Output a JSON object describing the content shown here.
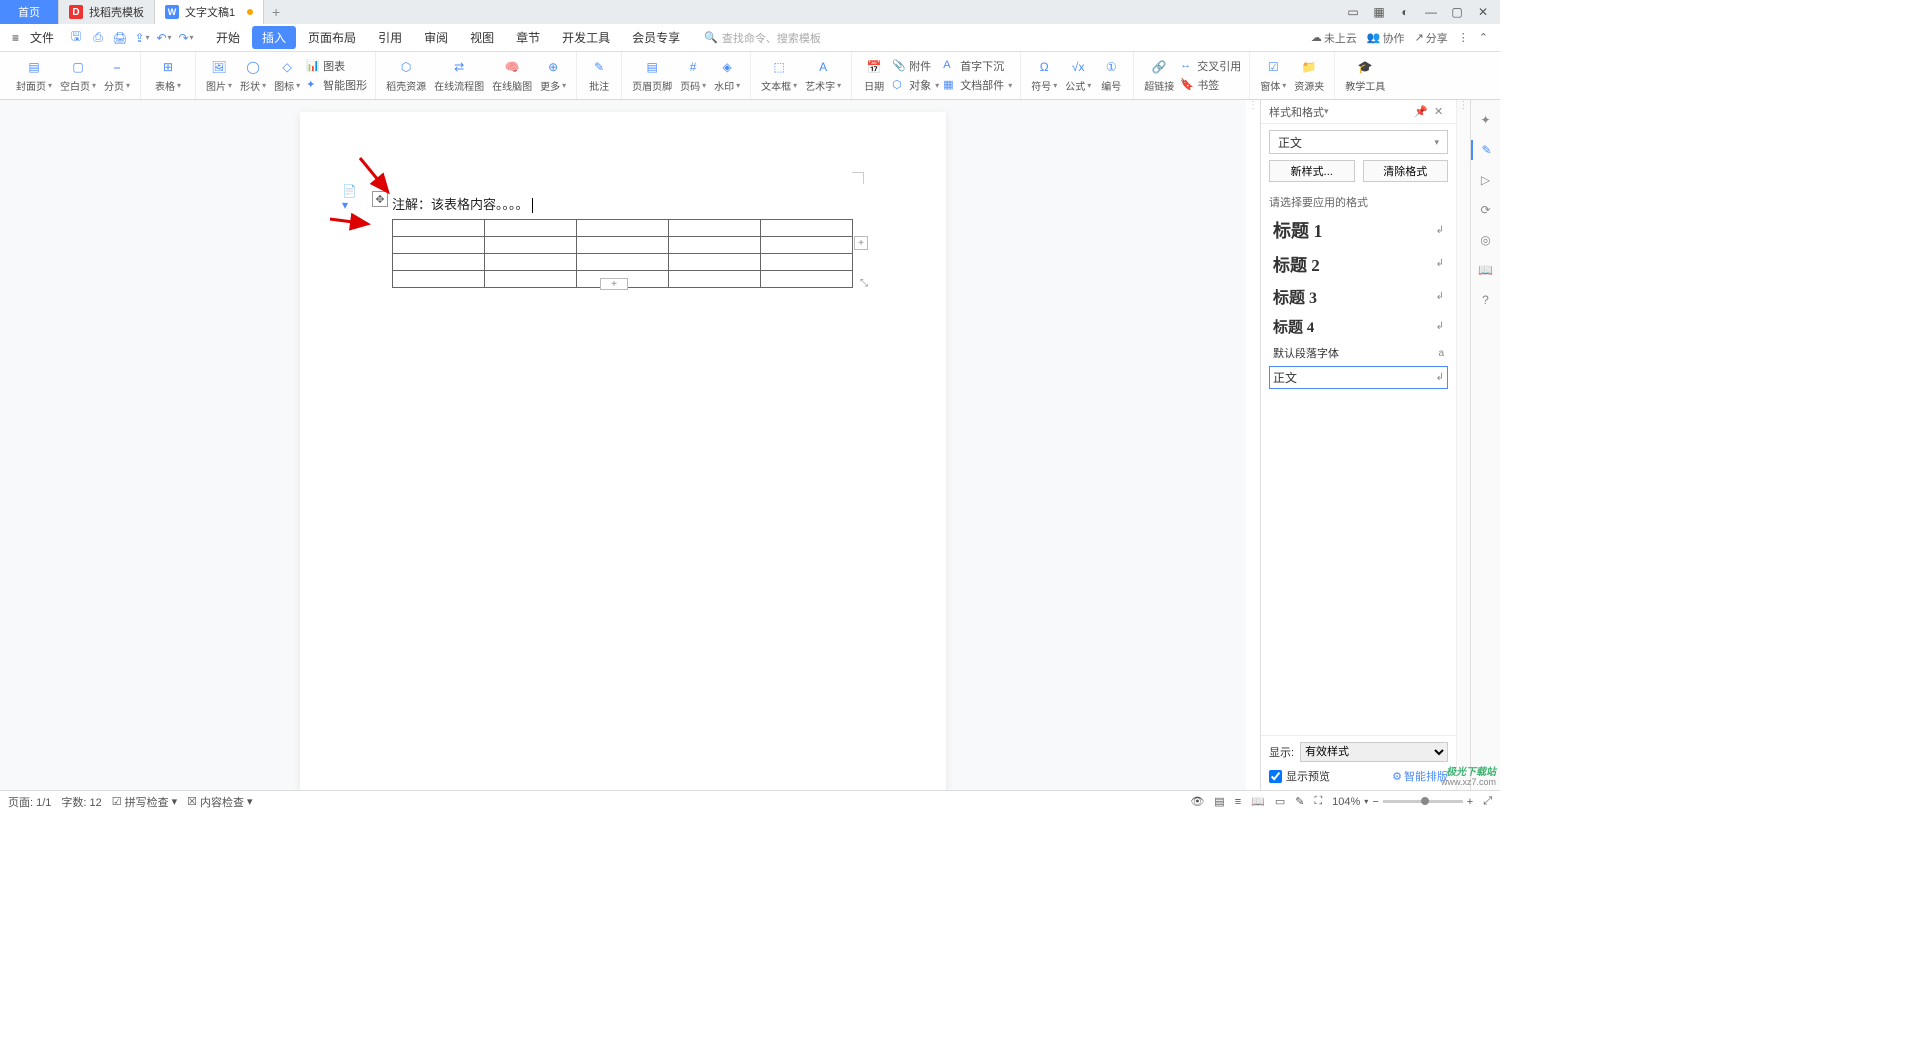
{
  "tabs": {
    "home": "首页",
    "templates": "找稻壳模板",
    "doc": "文字文稿1"
  },
  "file_menu": "文件",
  "menus": [
    "开始",
    "插入",
    "页面布局",
    "引用",
    "审阅",
    "视图",
    "章节",
    "开发工具",
    "会员专享"
  ],
  "active_menu": "插入",
  "search_placeholder": "查找命令、搜索模板",
  "top_right": {
    "not_cloud": "未上云",
    "collab": "协作",
    "share": "分享"
  },
  "ribbon": {
    "cover": "封面页",
    "blank": "空白页",
    "pagebreak": "分页",
    "table": "表格",
    "picture": "图片",
    "shape": "形状",
    "icon": "图标",
    "chart": "图表",
    "smart": "智能图形",
    "docer": "稻壳资源",
    "flow": "在线流程图",
    "mind": "在线脑图",
    "more": "更多",
    "comment": "批注",
    "headerfooter": "页眉页脚",
    "pagenum": "页码",
    "watermark": "水印",
    "textbox": "文本框",
    "wordart": "艺术字",
    "date": "日期",
    "attach": "附件",
    "object": "对象",
    "firstdrop": "首字下沉",
    "docpart": "文档部件",
    "symbol": "符号",
    "formula": "公式",
    "number": "编号",
    "hyperlink": "超链接",
    "crossref": "交叉引用",
    "bookmark": "书签",
    "form": "窗体",
    "resource": "资源夹",
    "edutools": "教学工具"
  },
  "document": {
    "annotation": "注解：该表格内容。。。。",
    "table_rows": 4,
    "table_cols": 5
  },
  "styles_panel": {
    "title": "样式和格式",
    "current": "正文",
    "new_style": "新样式...",
    "clear_format": "清除格式",
    "choose_label": "请选择要应用的格式",
    "items": [
      {
        "name": "标题 1",
        "cls": "h1"
      },
      {
        "name": "标题 2",
        "cls": "h2"
      },
      {
        "name": "标题 3",
        "cls": "h3"
      },
      {
        "name": "标题 4",
        "cls": "h4"
      },
      {
        "name": "默认段落字体",
        "cls": "small",
        "mark": "a"
      },
      {
        "name": "正文",
        "cls": "body",
        "selected": true
      }
    ],
    "show_label": "显示:",
    "show_value": "有效样式",
    "preview": "显示预览",
    "ai_layout": "智能排版"
  },
  "statusbar": {
    "page": "页面: 1/1",
    "words": "字数: 12",
    "spell": "拼写检查",
    "content": "内容检查",
    "zoom": "104%"
  },
  "watermark": {
    "line1": "极光下载站",
    "line2": "www.xz7.com"
  }
}
